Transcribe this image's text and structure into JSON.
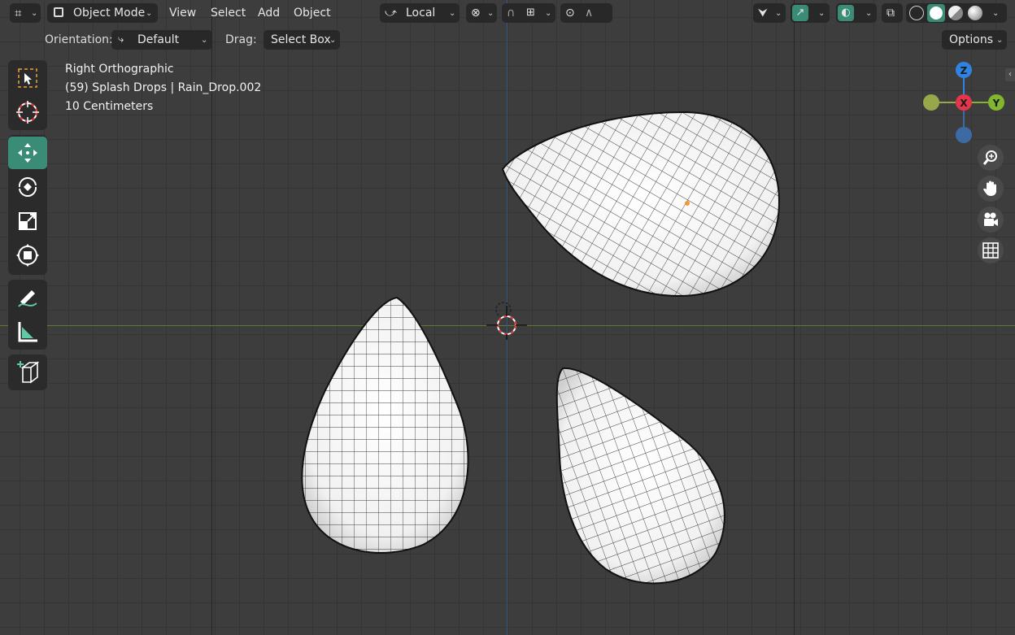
{
  "header": {
    "editor_type_icon": "grid-icon",
    "mode": "Object Mode",
    "menu": [
      "View",
      "Select",
      "Add",
      "Object"
    ],
    "transform_space": "Local",
    "shading_modes": [
      "wireframe",
      "solid",
      "material-preview",
      "rendered"
    ],
    "active_shading": "solid"
  },
  "tool_settings": {
    "orientation_label": "Orientation:",
    "orientation_value": "Default",
    "drag_label": "Drag:",
    "drag_value": "Select Box",
    "options_label": "Options"
  },
  "overlay": {
    "view_name": "Right Orthographic",
    "object_info": "(59) Splash Drops | Rain_Drop.002",
    "scale": "10 Centimeters"
  },
  "toolbar": [
    {
      "name": "select-box",
      "icon": "select-box-icon",
      "active": false
    },
    {
      "name": "cursor",
      "icon": "cursor-icon",
      "active": false
    },
    {
      "name": "move",
      "icon": "move-icon",
      "active": true
    },
    {
      "name": "rotate",
      "icon": "rotate-icon",
      "active": false
    },
    {
      "name": "scale",
      "icon": "scale-icon",
      "active": false
    },
    {
      "name": "transform",
      "icon": "transform-icon",
      "active": false
    },
    {
      "name": "annotate",
      "icon": "annotate-icon",
      "active": false
    },
    {
      "name": "measure",
      "icon": "measure-icon",
      "active": false
    },
    {
      "name": "add-cube",
      "icon": "add-cube-icon",
      "active": false
    }
  ],
  "gizmo": {
    "z": "Z",
    "x": "X",
    "y": "Y",
    "colors": {
      "z": "#2f83e3",
      "x": "#e3364a",
      "y": "#83b630",
      "neg_y": "#96a84a",
      "neg_z": "#3d6aa3"
    }
  },
  "nav_buttons": [
    "zoom-icon",
    "hand-icon",
    "camera-icon",
    "grid-view-icon"
  ],
  "colors": {
    "accent": "#3a8c77",
    "bg": "#3d3d3d",
    "header": "#282828"
  }
}
